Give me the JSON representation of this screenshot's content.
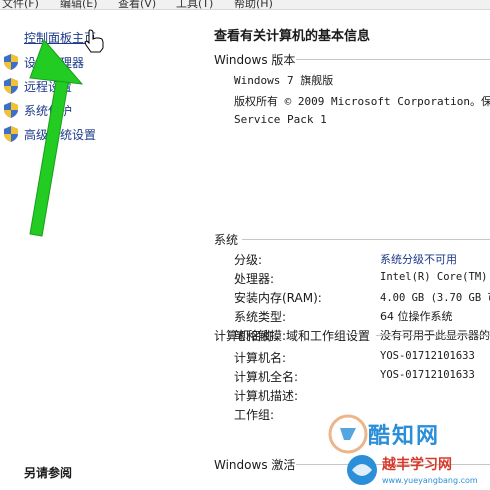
{
  "menubar": {
    "items": [
      "文件(F)",
      "编辑(E)",
      "查看(V)",
      "工具(T)",
      "帮助(H)"
    ]
  },
  "left_pane": {
    "home_link": "控制面板主页",
    "tasks": [
      {
        "label": "设备管理器",
        "icon": "shield-icon"
      },
      {
        "label": "远程设置",
        "icon": "shield-icon"
      },
      {
        "label": "系统保护",
        "icon": "shield-icon"
      },
      {
        "label": "高级系统设置",
        "icon": "shield-icon"
      }
    ],
    "see_also": "另请参阅"
  },
  "main": {
    "title": "查看有关计算机的基本信息",
    "windows_edition": {
      "heading": "Windows 版本",
      "name": "Windows 7 旗舰版",
      "copyright": "版权所有 © 2009 Microsoft Corporation。保",
      "service_pack": "Service Pack 1"
    },
    "system": {
      "heading": "系统",
      "rows": [
        {
          "key": "分级:",
          "value": "系统分级不可用",
          "link": true
        },
        {
          "key": "处理器:",
          "value": "Intel(R) Core(TM) i"
        },
        {
          "key": "安装内存(RAM):",
          "value": "4.00 GB (3.70 GB 可"
        },
        {
          "key": "系统类型:",
          "value": "64 位操作系统"
        },
        {
          "key": "笔和触摸:",
          "value": "没有可用于此显示器的"
        }
      ]
    },
    "computer_name": {
      "heading": "计算机名称、域和工作组设置",
      "rows": [
        {
          "key": "计算机名:",
          "value": "YOS-01712101633"
        },
        {
          "key": "计算机全名:",
          "value": "YOS-01712101633"
        },
        {
          "key": "计算机描述:",
          "value": ""
        },
        {
          "key": "工作组:",
          "value": ""
        }
      ]
    },
    "activation_heading": "Windows 激活"
  },
  "watermark": {
    "brand": "酷知网",
    "sub": "越丰学习网",
    "url": "www.yueyangbang.com"
  },
  "colors": {
    "link": "#1c3a8a",
    "arrow": "#22cc22",
    "watermark_blue": "#2a8fd8",
    "watermark_red": "#d63a2b"
  }
}
